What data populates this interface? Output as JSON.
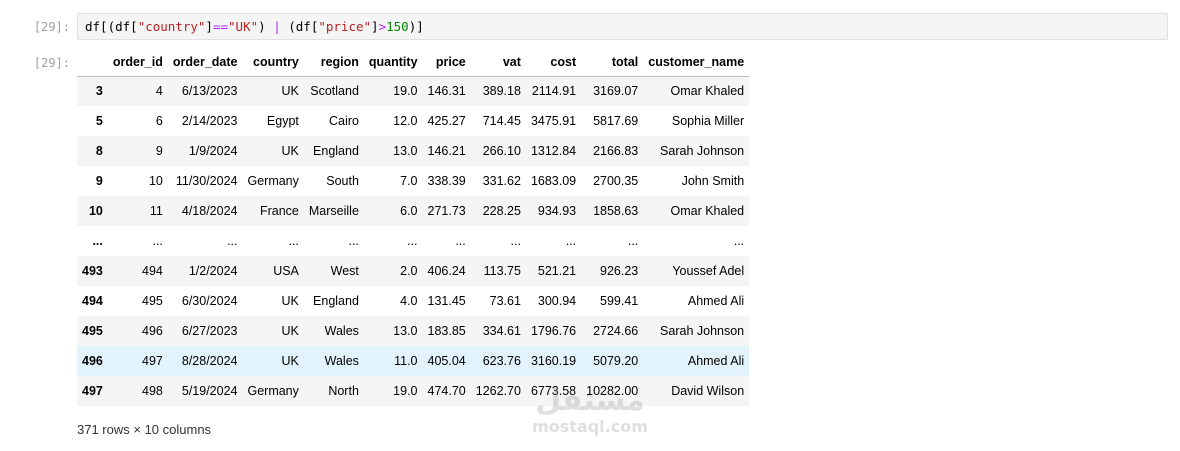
{
  "input_cell": {
    "prompt": "[29]:",
    "code_tokens": [
      {
        "text": "df[(df[",
        "kind": "plain"
      },
      {
        "text": "\"country\"",
        "kind": "str"
      },
      {
        "text": "]",
        "kind": "plain"
      },
      {
        "text": "==",
        "kind": "op"
      },
      {
        "text": "\"UK\"",
        "kind": "str"
      },
      {
        "text": ") ",
        "kind": "plain"
      },
      {
        "text": "|",
        "kind": "op"
      },
      {
        "text": " (df[",
        "kind": "plain"
      },
      {
        "text": "\"price\"",
        "kind": "str"
      },
      {
        "text": "]",
        "kind": "plain"
      },
      {
        "text": ">",
        "kind": "op"
      },
      {
        "text": "150",
        "kind": "num"
      },
      {
        "text": ")]",
        "kind": "plain"
      }
    ]
  },
  "output_cell": {
    "prompt": "[29]:",
    "columns": [
      "order_id",
      "order_date",
      "country",
      "region",
      "quantity",
      "price",
      "vat",
      "cost",
      "total",
      "customer_name"
    ],
    "rows": [
      {
        "index": "3",
        "cells": [
          "4",
          "6/13/2023",
          "UK",
          "Scotland",
          "19.0",
          "146.31",
          "389.18",
          "2114.91",
          "3169.07",
          "Omar Khaled"
        ]
      },
      {
        "index": "5",
        "cells": [
          "6",
          "2/14/2023",
          "Egypt",
          "Cairo",
          "12.0",
          "425.27",
          "714.45",
          "3475.91",
          "5817.69",
          "Sophia Miller"
        ]
      },
      {
        "index": "8",
        "cells": [
          "9",
          "1/9/2024",
          "UK",
          "England",
          "13.0",
          "146.21",
          "266.10",
          "1312.84",
          "2166.83",
          "Sarah Johnson"
        ]
      },
      {
        "index": "9",
        "cells": [
          "10",
          "11/30/2024",
          "Germany",
          "South",
          "7.0",
          "338.39",
          "331.62",
          "1683.09",
          "2700.35",
          "John Smith"
        ]
      },
      {
        "index": "10",
        "cells": [
          "11",
          "4/18/2024",
          "France",
          "Marseille",
          "6.0",
          "271.73",
          "228.25",
          "934.93",
          "1858.63",
          "Omar Khaled"
        ]
      },
      {
        "index": "...",
        "cells": [
          "...",
          "...",
          "...",
          "...",
          "...",
          "...",
          "...",
          "...",
          "...",
          "..."
        ]
      },
      {
        "index": "493",
        "cells": [
          "494",
          "1/2/2024",
          "USA",
          "West",
          "2.0",
          "406.24",
          "113.75",
          "521.21",
          "926.23",
          "Youssef Adel"
        ]
      },
      {
        "index": "494",
        "cells": [
          "495",
          "6/30/2024",
          "UK",
          "England",
          "4.0",
          "131.45",
          "73.61",
          "300.94",
          "599.41",
          "Ahmed Ali"
        ]
      },
      {
        "index": "495",
        "cells": [
          "496",
          "6/27/2023",
          "UK",
          "Wales",
          "13.0",
          "183.85",
          "334.61",
          "1796.76",
          "2724.66",
          "Sarah Johnson"
        ]
      },
      {
        "index": "496",
        "cells": [
          "497",
          "8/28/2024",
          "UK",
          "Wales",
          "11.0",
          "405.04",
          "623.76",
          "3160.19",
          "5079.20",
          "Ahmed Ali"
        ],
        "hovered": true
      },
      {
        "index": "497",
        "cells": [
          "498",
          "5/19/2024",
          "Germany",
          "North",
          "19.0",
          "474.70",
          "1262.70",
          "6773.58",
          "10282.00",
          "David Wilson"
        ]
      }
    ],
    "summary": "371 rows × 10 columns"
  },
  "watermark": {
    "glyph": "مستقل",
    "text": "mostaql.com"
  },
  "colors": {
    "string": "#ba2121",
    "operator": "#aa22ff",
    "number": "#008800",
    "hover_row": "#e3f3fb",
    "stripe_row": "#f5f5f5"
  }
}
